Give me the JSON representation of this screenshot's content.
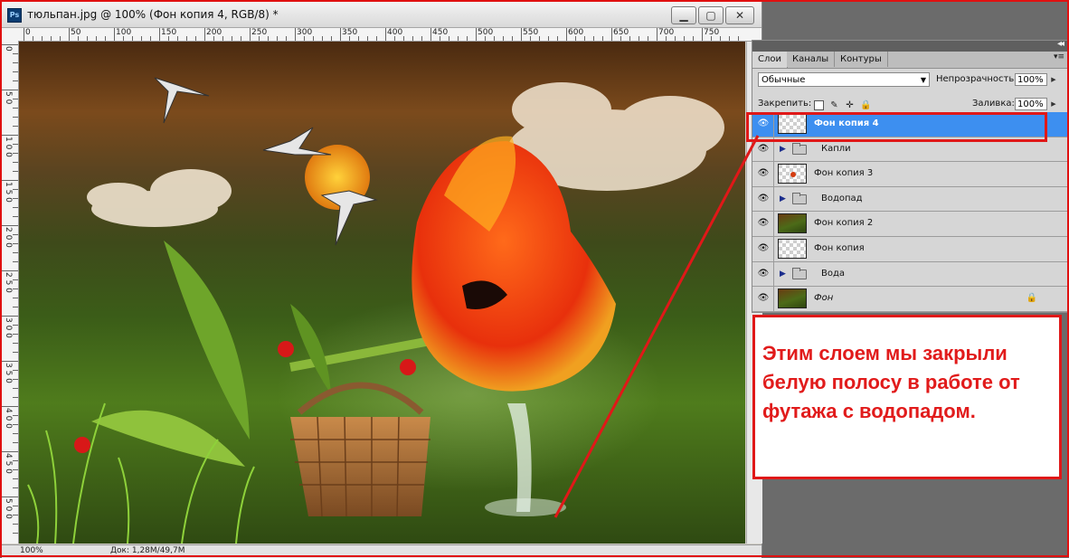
{
  "document": {
    "app_icon": "Ps",
    "title": "тюльпан.jpg @ 100% (Фон копия 4, RGB/8) *",
    "window_buttons": [
      "minimize-icon",
      "restore-icon",
      "close-icon"
    ],
    "ruler_top_labels": [
      "0",
      "50",
      "100",
      "150",
      "200",
      "250",
      "300",
      "350",
      "400",
      "450",
      "500",
      "550",
      "600",
      "650",
      "700",
      "750"
    ],
    "ruler_left_labels": [
      "0",
      "5 0",
      "1 0 0",
      "1 5 0",
      "2 0 0",
      "2 5 0",
      "3 0 0",
      "3 5 0",
      "4 0 0",
      "4 5 0",
      "5 0 0"
    ],
    "status": {
      "zoom": "100%",
      "doc_size": "Док: 1,28M/49,7M"
    }
  },
  "panel": {
    "collapse_icon": "double-chevron-icon",
    "tabs": [
      "Слои",
      "Каналы",
      "Контуры"
    ],
    "active_tab": "Слои",
    "menu_icon": "panel-menu-icon",
    "blend_mode": "Обычные",
    "opacity_label": "Непрозрачность:",
    "opacity_value": "100%",
    "lock_label": "Закрепить:",
    "fill_label": "Заливка:",
    "fill_value": "100%",
    "lock_icons": [
      "lock-transparency-icon",
      "lock-paint-icon",
      "lock-move-icon",
      "lock-all-icon"
    ],
    "layers": [
      {
        "name": "Фон копия 4",
        "type": "layer",
        "thumb": "transparent",
        "selected": true
      },
      {
        "name": "Капли",
        "type": "group"
      },
      {
        "name": "Фон копия 3",
        "type": "layer",
        "thumb": "transparent-dot"
      },
      {
        "name": "Водопад",
        "type": "group"
      },
      {
        "name": "Фон копия 2",
        "type": "layer",
        "thumb": "image"
      },
      {
        "name": "Фон копия",
        "type": "layer",
        "thumb": "transparent"
      },
      {
        "name": "Вода",
        "type": "group"
      },
      {
        "name": "Фон",
        "type": "layer",
        "thumb": "image",
        "locked": true,
        "italic": true
      }
    ]
  },
  "annotation": {
    "text": "Этим слоем мы закрыли белую полосу в работе от футажа с водопадом.",
    "color": "#e01818"
  }
}
